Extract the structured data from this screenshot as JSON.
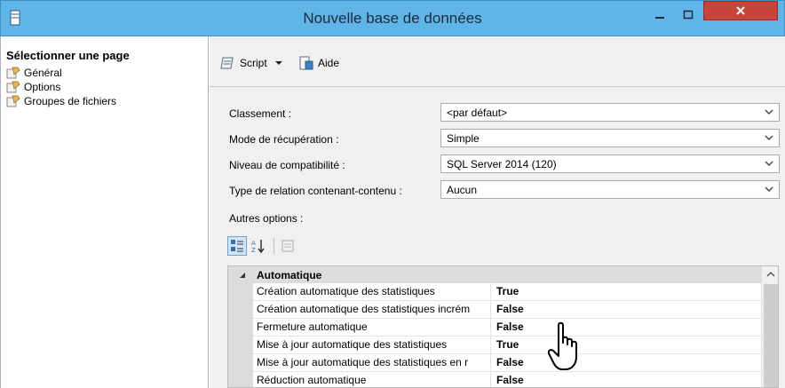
{
  "window": {
    "title": "Nouvelle base de données",
    "accent": "#5fb4e8",
    "close_color": "#c6443a"
  },
  "left": {
    "header": "Sélectionner une page",
    "items": [
      {
        "label": "Général",
        "icon": "page-icon"
      },
      {
        "label": "Options",
        "icon": "page-icon"
      },
      {
        "label": "Groupes de fichiers",
        "icon": "page-icon"
      }
    ]
  },
  "toolbar": {
    "script_label": "Script",
    "help_label": "Aide"
  },
  "form": {
    "collation": {
      "label": "Classement :",
      "value": "<par défaut>"
    },
    "recovery": {
      "label": "Mode de récupération :",
      "value": "Simple"
    },
    "compat": {
      "label": "Niveau de compatibilité :",
      "value": "SQL Server 2014 (120)"
    },
    "containment": {
      "label": "Type de relation contenant-contenu :",
      "value": "Aucun"
    }
  },
  "other_options_label": "Autres options :",
  "grid": {
    "category": "Automatique",
    "rows": [
      {
        "name": "Création automatique des statistiques",
        "value": "True"
      },
      {
        "name": "Création automatique des statistiques incrém",
        "value": "False"
      },
      {
        "name": "Fermeture automatique",
        "value": "False"
      },
      {
        "name": "Mise à jour automatique des statistiques",
        "value": "True"
      },
      {
        "name": "Mise à jour automatique des statistiques en r",
        "value": "False"
      },
      {
        "name": "Réduction automatique",
        "value": "False"
      }
    ]
  }
}
